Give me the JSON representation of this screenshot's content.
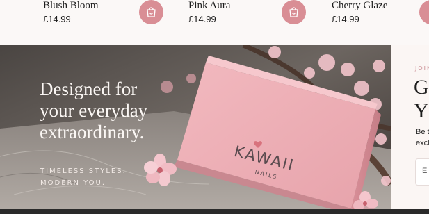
{
  "products": [
    {
      "name": "Blush Bloom",
      "price": "£14.99"
    },
    {
      "name": "Pink Aura",
      "price": "£14.99"
    },
    {
      "name": "Cherry Glaze",
      "price": "£14.99"
    }
  ],
  "icons": {
    "add_to_bag": "shopping-bag-icon"
  },
  "hero": {
    "headline": [
      "Designed for",
      "your everyday",
      "extraordinary."
    ],
    "tagline": [
      "TIMELESS STYLES.",
      "MODERN YOU."
    ],
    "box_brand": "KAWAII",
    "box_sub": "NAILS"
  },
  "newsletter": {
    "kicker": "JOIN",
    "title": [
      "G",
      "Y"
    ],
    "body": [
      "Be t",
      "excl"
    ],
    "input_placeholder": "E"
  },
  "colors": {
    "accent": "#d98e95",
    "background": "#fbf7f6",
    "text": "#1c1c1c"
  }
}
